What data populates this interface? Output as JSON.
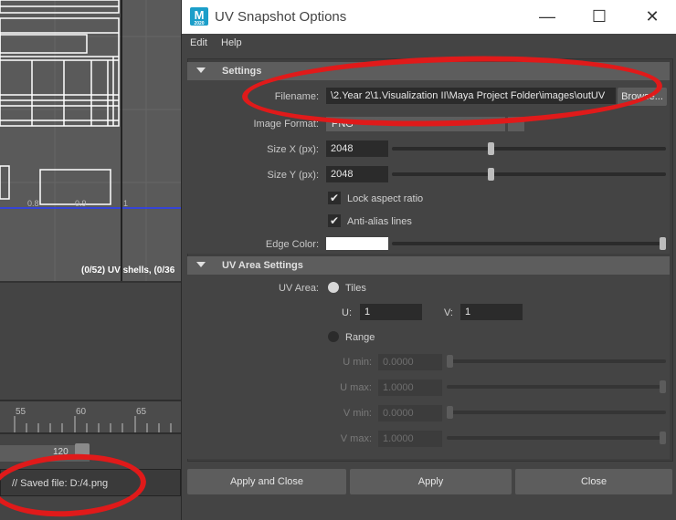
{
  "uv_editor": {
    "status_text": "(0/52) UV shells, (0/36",
    "ticks": [
      "0.8",
      "0.9",
      "1"
    ]
  },
  "timeline": {
    "frames": [
      "55",
      "60",
      "65"
    ]
  },
  "range": {
    "end_value": "120"
  },
  "command_line": {
    "text": "// Saved file: D:/4.png"
  },
  "dialog": {
    "title": "UV Snapshot Options",
    "logo_letter": "M",
    "logo_sub": "2020",
    "window_controls": {
      "minimize": "—",
      "maximize": "☐",
      "close": "✕"
    },
    "menu": [
      "Edit",
      "Help"
    ],
    "settings": {
      "header": "Settings",
      "filename_label": "Filename:",
      "filename_value": "\\2.Year 2\\1.Visualization II\\Maya Project Folder\\images\\outUV",
      "browse_label": "Browse...",
      "image_format_label": "Image Format:",
      "image_format_value": "PNG",
      "size_x_label": "Size X (px):",
      "size_x_value": "2048",
      "size_x_fraction": 0.36,
      "size_y_label": "Size Y (px):",
      "size_y_value": "2048",
      "size_y_fraction": 0.36,
      "lock_aspect_label": "Lock aspect ratio",
      "lock_aspect_checked": true,
      "anti_alias_label": "Anti-alias lines",
      "anti_alias_checked": true,
      "edge_color_label": "Edge Color:",
      "edge_color_value": "#ffffff",
      "edge_color_fraction": 1.0
    },
    "uv_area": {
      "header": "UV Area Settings",
      "uv_area_label": "UV Area:",
      "tiles_label": "Tiles",
      "u_label": "U:",
      "u_value": "1",
      "v_label": "V:",
      "v_value": "1",
      "range_label": "Range",
      "umin_label": "U min:",
      "umin_value": "0.0000",
      "umax_label": "U max:",
      "umax_value": "1.0000",
      "vmin_label": "V min:",
      "vmin_value": "0.0000",
      "vmax_label": "V max:",
      "vmax_value": "1.0000"
    },
    "buttons": {
      "apply_close": "Apply and Close",
      "apply": "Apply",
      "close": "Close"
    }
  }
}
